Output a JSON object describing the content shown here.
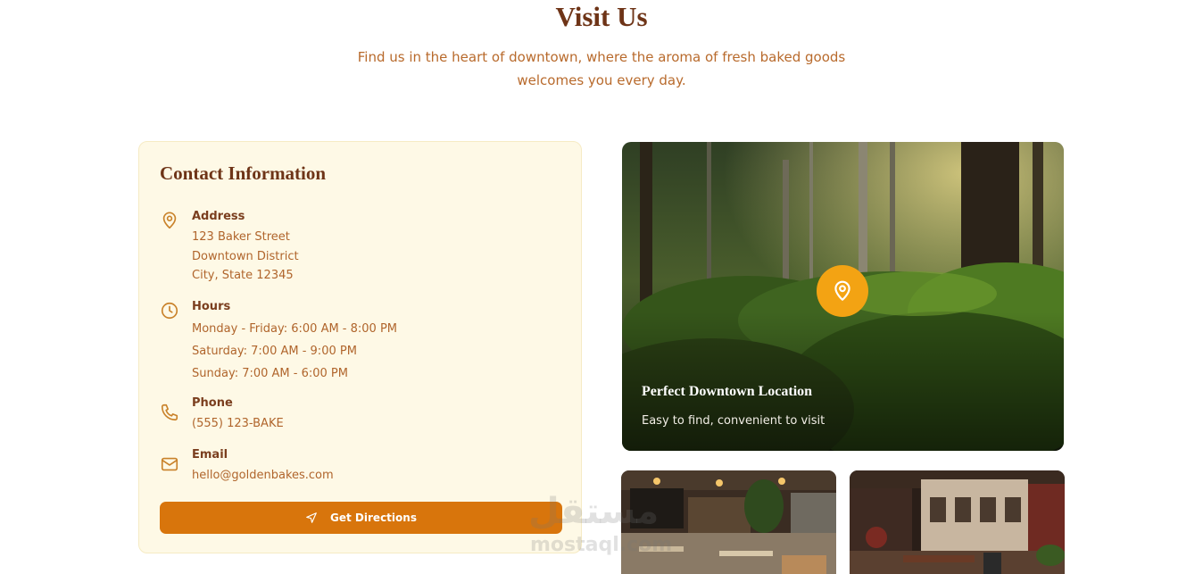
{
  "section": {
    "title": "Visit Us",
    "subtitle": "Find us in the heart of downtown, where the aroma of fresh baked goods welcomes you every day."
  },
  "contact": {
    "title": "Contact Information",
    "address": {
      "label": "Address",
      "lines": [
        "123 Baker Street",
        "Downtown District",
        "City, State 12345"
      ],
      "icon": "map-pin-icon"
    },
    "hours": {
      "label": "Hours",
      "lines": [
        "Monday - Friday: 6:00 AM - 8:00 PM",
        "Saturday: 7:00 AM - 9:00 PM",
        "Sunday: 7:00 AM - 6:00 PM"
      ],
      "icon": "clock-icon"
    },
    "phone": {
      "label": "Phone",
      "value": "(555) 123-BAKE",
      "icon": "phone-icon"
    },
    "email": {
      "label": "Email",
      "value": "hello@goldenbakes.com",
      "icon": "mail-icon"
    },
    "directions_button": {
      "label": "Get Directions",
      "icon": "navigation-icon"
    }
  },
  "hero": {
    "title": "Perfect Downtown Location",
    "subtitle": "Easy to find, convenient to visit",
    "icon": "map-pin-icon"
  },
  "watermark": {
    "logo": "مستقل",
    "text": "mostaql.com"
  },
  "colors": {
    "brown": "#6e3417",
    "accent_orange": "#d8750c",
    "pin_yellow": "#f3a313",
    "card_bg": "#fef9e6",
    "muted_text": "#b0652c"
  }
}
